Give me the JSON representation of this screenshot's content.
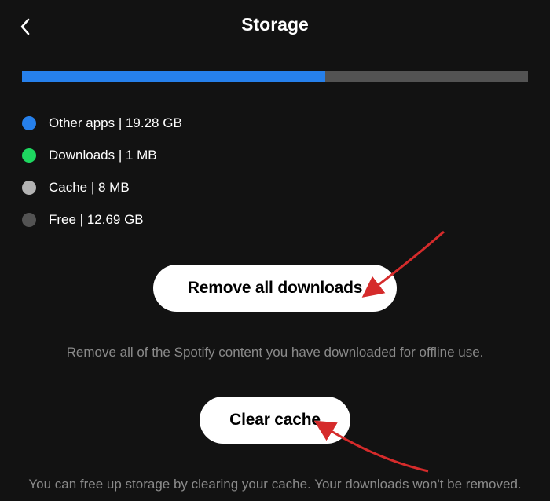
{
  "header": {
    "title": "Storage"
  },
  "progress": {
    "fill_percent": 60
  },
  "legend": [
    {
      "label": "Other apps | 19.28 GB",
      "color": "#2680eb"
    },
    {
      "label": "Downloads | 1 MB",
      "color": "#1ed760"
    },
    {
      "label": "Cache | 8 MB",
      "color": "#b3b3b3"
    },
    {
      "label": "Free | 12.69 GB",
      "color": "#535353"
    }
  ],
  "buttons": {
    "remove_downloads": "Remove all downloads",
    "clear_cache": "Clear cache"
  },
  "descriptions": {
    "remove_downloads": "Remove all of the Spotify content you have downloaded for offline use.",
    "clear_cache": "You can free up storage by clearing your cache. Your downloads won't be removed."
  },
  "chart_data": {
    "type": "bar",
    "title": "Storage",
    "categories": [
      "Other apps",
      "Downloads",
      "Cache",
      "Free"
    ],
    "values_gb": [
      19.28,
      0.001,
      0.008,
      12.69
    ],
    "display": [
      "19.28 GB",
      "1 MB",
      "8 MB",
      "12.69 GB"
    ],
    "colors": [
      "#2680eb",
      "#1ed760",
      "#b3b3b3",
      "#535353"
    ]
  }
}
